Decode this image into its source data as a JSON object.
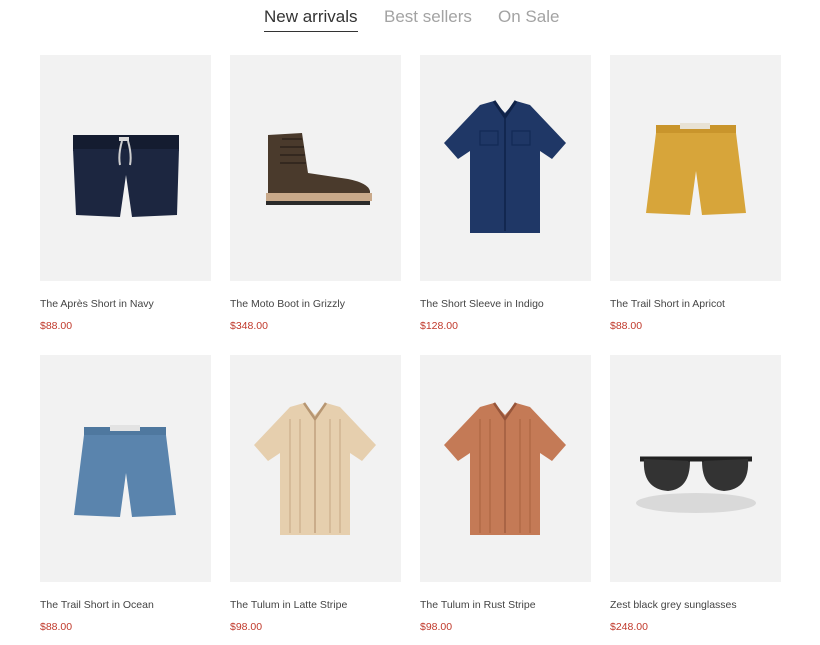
{
  "tabs": [
    {
      "label": "New arrivals",
      "active": true
    },
    {
      "label": "Best sellers",
      "active": false
    },
    {
      "label": "On Sale",
      "active": false
    }
  ],
  "products": [
    {
      "name": "The Après Short in Navy",
      "price": "$88.00",
      "icon": "navy-shorts-image",
      "color": "#1c2640"
    },
    {
      "name": "The Moto Boot in Grizzly",
      "price": "$348.00",
      "icon": "brown-boot-image",
      "color": "#4a3a2c"
    },
    {
      "name": "The Short Sleeve in Indigo",
      "price": "$128.00",
      "icon": "indigo-shirt-image",
      "color": "#1f3766"
    },
    {
      "name": "The Trail Short in Apricot",
      "price": "$88.00",
      "icon": "apricot-shorts-image",
      "color": "#d7a53a"
    },
    {
      "name": "The Trail Short in Ocean",
      "price": "$88.00",
      "icon": "ocean-shorts-image",
      "color": "#5a84ad"
    },
    {
      "name": "The Tulum in Latte Stripe",
      "price": "$98.00",
      "icon": "latte-shirt-image",
      "color": "#e6cfae"
    },
    {
      "name": "The Tulum in Rust Stripe",
      "price": "$98.00",
      "icon": "rust-shirt-image",
      "color": "#c47a56"
    },
    {
      "name": "Zest black grey sunglasses",
      "price": "$248.00",
      "icon": "sunglasses-image",
      "color": "#222222"
    }
  ],
  "colors": {
    "accent_price": "#c0392b",
    "image_bg": "#f2f2f2",
    "tab_inactive": "#a3a3a3",
    "tab_active": "#333333"
  }
}
